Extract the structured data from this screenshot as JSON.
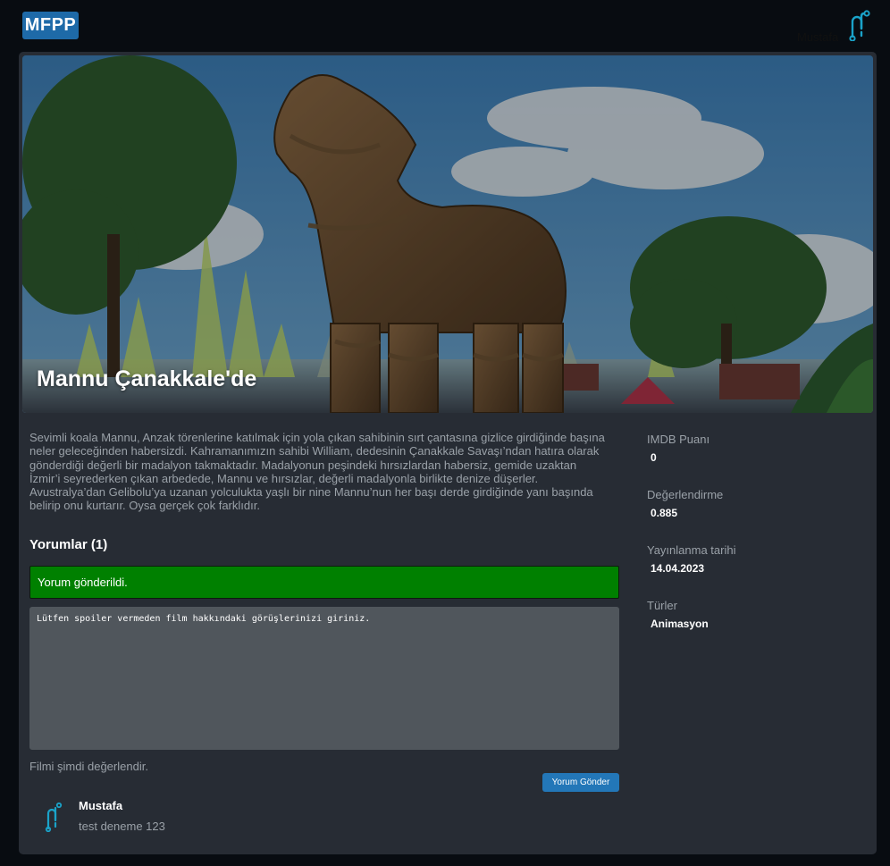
{
  "header": {
    "logo_text": "MFPP",
    "user_name": "Mustafa",
    "user_icon": "user-avatar-icon"
  },
  "movie": {
    "title": "Mannu Çanakkale'de",
    "hero_image": "trojan-horse-scene",
    "description": "Sevimli koala Mannu, Anzak törenlerine katılmak için yola çıkan sahibinin sırt çantasına gizlice girdiğinde başına neler geleceğinden habersizdi. Kahramanımızın sahibi William, dedesinin Çanakkale Savaşı’ndan hatıra olarak gönderdiği değerli bir madalyon takmaktadır. Madalyonun peşindeki hırsızlardan habersiz, gemide uzaktan İzmir’i seyrederken çıkan arbedede, Mannu ve hırsızlar, değerli madalyonla birlikte denize düşerler. Avustralya’dan Gelibolu’ya uzanan yolculukta yaşlı bir nine Mannu’nun her başı derde girdiğinde yanı başında belirip onu kurtarır. Oysa gerçek çok farklıdır."
  },
  "comments": {
    "title": "Yorumlar (1)",
    "success_message": "Yorum gönderildi.",
    "placeholder": "Lütfen spoiler vermeden film hakkındaki görüşlerinizi giriniz.",
    "rate_prompt": "Filmi şimdi değerlendir.",
    "send_label": "Yorum Gönder",
    "items": [
      {
        "author": "Mustafa",
        "text": "test deneme 123",
        "avatar_icon": "user-avatar-icon"
      }
    ]
  },
  "sidebar": {
    "imdb_label": "IMDB Puanı",
    "imdb_value": "0",
    "rating_label": "Değerlendirme",
    "rating_value": "0.885",
    "release_label": "Yayınlanma tarihi",
    "release_value": "14.04.2023",
    "genres_label": "Türler",
    "genres_value": "Animasyon"
  },
  "colors": {
    "background": "#080c11",
    "card": "#272c34",
    "accent": "#1e6aa8",
    "success": "#008000",
    "textarea": "#50565c"
  }
}
